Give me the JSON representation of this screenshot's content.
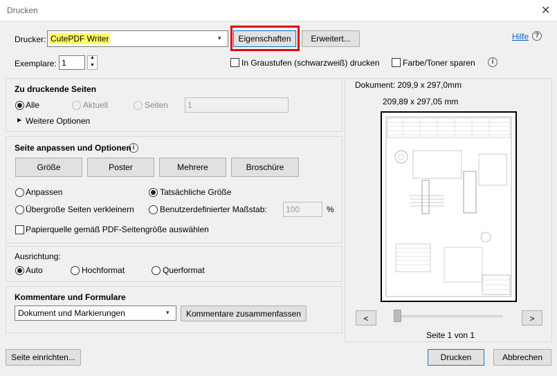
{
  "window": {
    "title": "Drucken"
  },
  "printer": {
    "label": "Drucker:",
    "value": "CutePDF Writer",
    "properties_button": "Eigenschaften",
    "advanced_button": "Erweitert...",
    "help_link": "Hilfe",
    "highlight_color": "#ffff66",
    "focus_outline_color": "#e00000"
  },
  "copies": {
    "label": "Exemplare:",
    "value": "1"
  },
  "options": {
    "grayscale": "In Graustufen (schwarzweiß) drucken",
    "save_toner": "Farbe/Toner sparen"
  },
  "pages": {
    "heading": "Zu druckende Seiten",
    "all": "Alle",
    "current": "Aktuell",
    "pages": "Seiten",
    "pages_value": "1",
    "more_options": "Weitere Optionen"
  },
  "fit": {
    "heading": "Seite anpassen und Optionen",
    "buttons": [
      "Größe",
      "Poster",
      "Mehrere",
      "Broschüre"
    ],
    "fit": "Anpassen",
    "actual_size": "Tatsächliche Größe",
    "shrink": "Übergroße Seiten verkleinern",
    "custom_scale": "Benutzerdefinierter Maßstab:",
    "scale_value": "100",
    "scale_unit": "%",
    "paper_source": "Papierquelle gemäß PDF-Seitengröße auswählen"
  },
  "orientation": {
    "heading": "Ausrichtung:",
    "auto": "Auto",
    "portrait": "Hochformat",
    "landscape": "Querformat"
  },
  "comments": {
    "heading": "Kommentare und Formulare",
    "select_value": "Dokument und Markierungen",
    "summarize_button": "Kommentare zusammenfassen"
  },
  "preview": {
    "document_size": "Dokument: 209,9 x 297,0mm",
    "page_size": "209,89 x 297,05 mm",
    "prev": "<",
    "next": ">",
    "page_info": "Seite 1 von 1"
  },
  "footer": {
    "page_setup": "Seite einrichten...",
    "print": "Drucken",
    "cancel": "Abbrechen"
  }
}
